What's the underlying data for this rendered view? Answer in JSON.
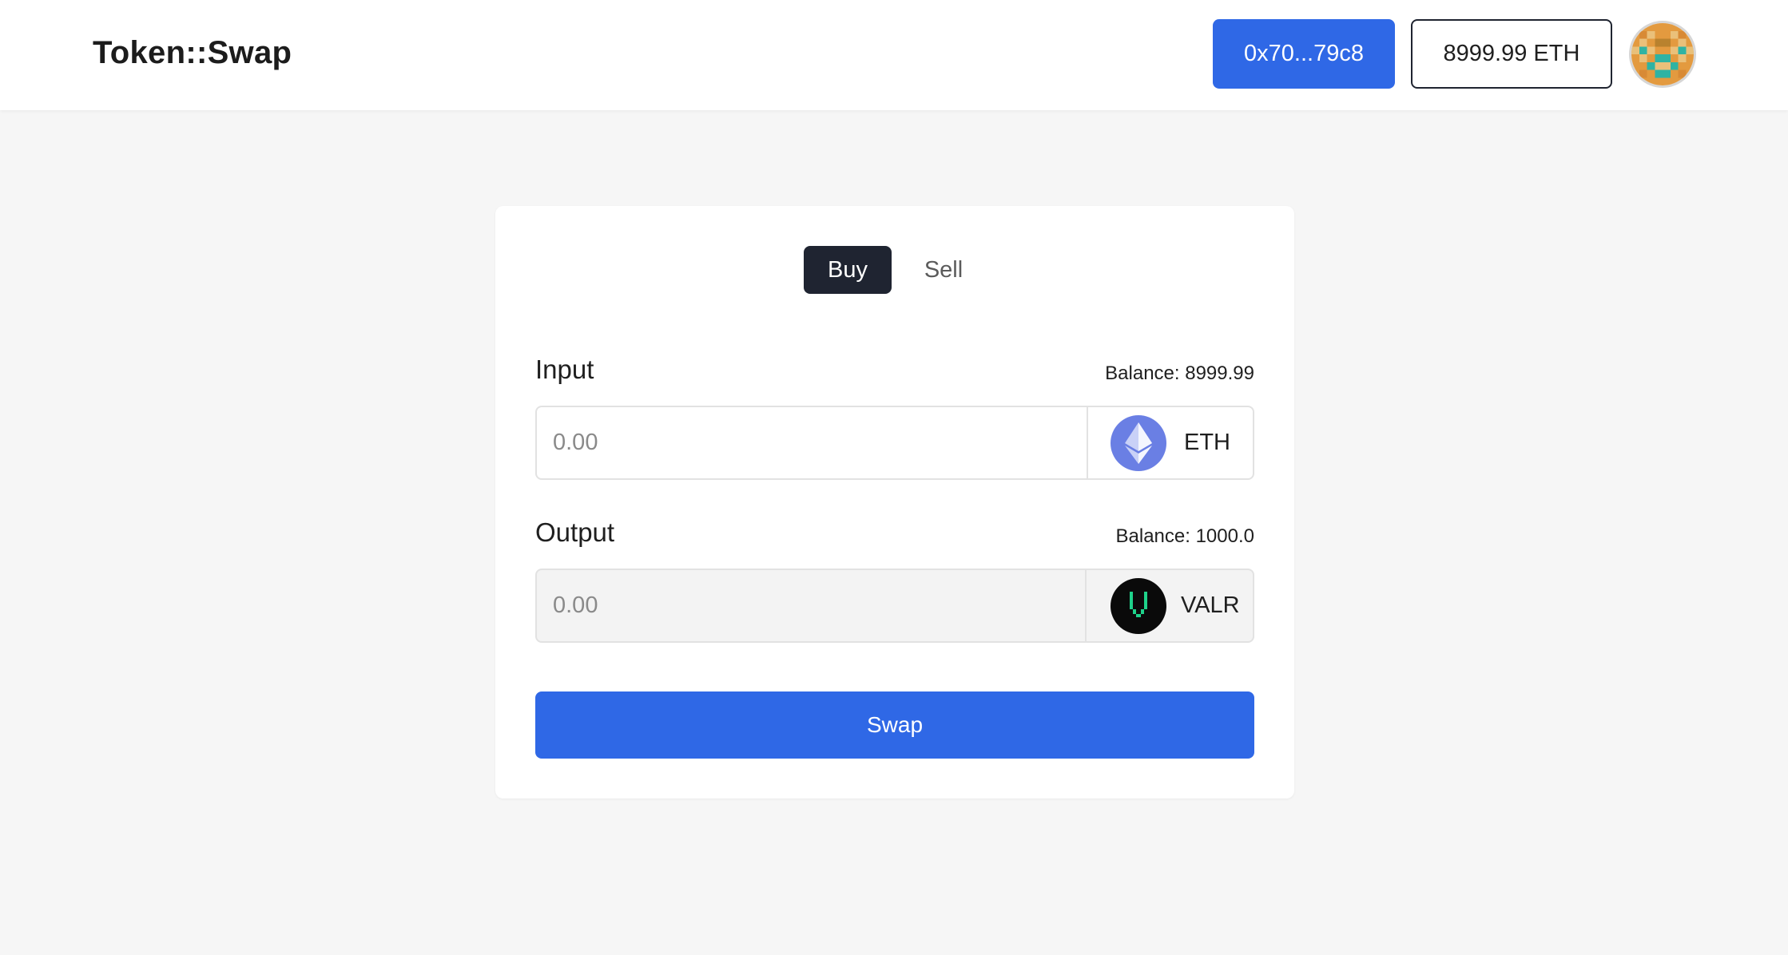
{
  "header": {
    "logo": "Token::Swap",
    "wallet_address": "0x70...79c8",
    "wallet_balance": "8999.99 ETH"
  },
  "tabs": [
    {
      "label": "Buy",
      "active": true
    },
    {
      "label": "Sell",
      "active": false
    }
  ],
  "input": {
    "label": "Input",
    "balance": "Balance: 8999.99",
    "placeholder": "0.00",
    "token": "ETH",
    "token_icon": "ethereum-icon"
  },
  "output": {
    "label": "Output",
    "balance": "Balance: 1000.0",
    "placeholder": "0.00",
    "token": "VALR",
    "token_icon": "valr-icon"
  },
  "swap_label": "Swap",
  "colors": {
    "primary": "#2f68e6",
    "dark": "#1f2431",
    "eth": "#6a7fe4",
    "valr": "#0a0a0a",
    "valr_accent": "#1ed28a"
  }
}
